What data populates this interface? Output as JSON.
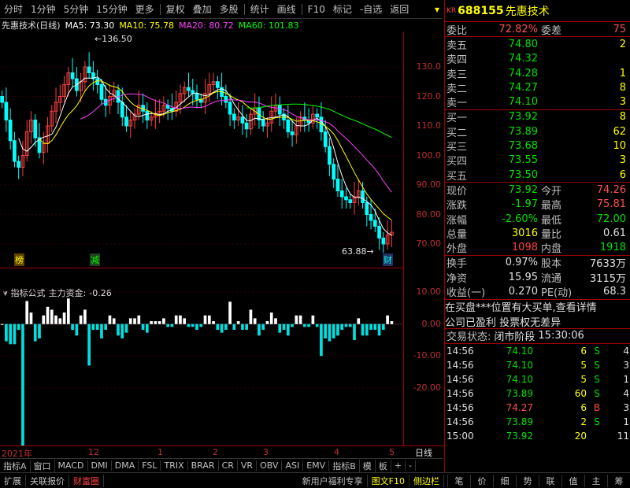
{
  "toolbar": {
    "items": [
      "分时",
      "1分钟",
      "5分钟",
      "15分钟",
      "更多",
      "复权",
      "叠加",
      "多股",
      "统计",
      "画线",
      "F10",
      "标记",
      "-自选",
      "返回"
    ]
  },
  "chart_title": {
    "name": "先惠技术(日线)",
    "ma5": "MA5: 73.30",
    "ma10": "MA10: 75.78",
    "ma20": "MA20: 80.72",
    "ma60": "MA60: 101.83"
  },
  "colors": {
    "ma5": "#ffffff",
    "ma10": "#ffff00",
    "ma20": "#ff40ff",
    "ma60": "#00ff00",
    "up": "#ff4040",
    "down": "#00ffff"
  },
  "price_axis": {
    "labels": [
      "130.0",
      "120.0",
      "110.0",
      "100.0",
      "90.00",
      "80.00",
      "70.00"
    ]
  },
  "ind_axis": {
    "labels": [
      "10.00",
      "0.00",
      "-10.00",
      "-20.00"
    ]
  },
  "annotations": {
    "high": "136.50",
    "low": "63.88",
    "tag_bang": "榜",
    "tag_jian": "减",
    "tag_cai": "财"
  },
  "indicator": {
    "label": "指标公式",
    "name": "主力资金:",
    "value": "-0.26"
  },
  "xaxis": {
    "labels": [
      "2021年",
      "12",
      "1",
      "2",
      "3",
      "4",
      "5"
    ],
    "period": "日线"
  },
  "tabs": [
    "指标A",
    "窗口",
    "MACD",
    "DMI",
    "DMA",
    "FSL",
    "TRIX",
    "BRAR",
    "CR",
    "VR",
    "OBV",
    "ASI",
    "EMV",
    "指标B",
    "模",
    "板",
    "+",
    "-"
  ],
  "bottom": {
    "items": [
      "扩展",
      "关联报价",
      "财富圈",
      "新用户福利专享",
      "图文F10",
      "侧边栏"
    ],
    "right": [
      "笔",
      "价",
      "细",
      "势",
      "联",
      "值",
      "主",
      "筹"
    ]
  },
  "stock": {
    "kr": "KR",
    "code": "688155",
    "name": "先惠技术"
  },
  "commission": {
    "ratio_label": "委比",
    "ratio": "72.82%",
    "diff_label": "委差",
    "diff": "75"
  },
  "sell": [
    {
      "k": "卖五",
      "p": "74.80",
      "v": "2"
    },
    {
      "k": "卖四",
      "p": "74.32",
      "v": ""
    },
    {
      "k": "卖三",
      "p": "74.28",
      "v": "1"
    },
    {
      "k": "卖二",
      "p": "74.27",
      "v": "8"
    },
    {
      "k": "卖一",
      "p": "74.10",
      "v": "3"
    }
  ],
  "buy": [
    {
      "k": "买一",
      "p": "73.92",
      "v": "8"
    },
    {
      "k": "买二",
      "p": "73.89",
      "v": "62"
    },
    {
      "k": "买三",
      "p": "73.68",
      "v": "10"
    },
    {
      "k": "买四",
      "p": "73.55",
      "v": "3"
    },
    {
      "k": "买五",
      "p": "73.50",
      "v": "6"
    }
  ],
  "quote": [
    {
      "k1": "现价",
      "v1": "73.92",
      "k2": "今开",
      "v2": "74.26"
    },
    {
      "k1": "涨跌",
      "v1": "-1.97",
      "k2": "最高",
      "v2": "75.81"
    },
    {
      "k1": "涨幅",
      "v1": "-2.60%",
      "k2": "最低",
      "v2": "72.00"
    },
    {
      "k1": "总量",
      "v1": "3016",
      "k2": "量比",
      "v2": "0.61"
    },
    {
      "k1": "外盘",
      "v1": "1098",
      "k2": "内盘",
      "v2": "1918"
    }
  ],
  "stats": [
    {
      "k1": "换手",
      "v1": "0.97%",
      "k2": "股本",
      "v2": "7633万"
    },
    {
      "k1": "净资",
      "v1": "15.95",
      "k2": "流通",
      "v2": "3115万"
    },
    {
      "k1": "收益(一)",
      "v1": "0.270",
      "k2": "PE(动)",
      "v2": "68.3"
    }
  ],
  "news": [
    "在买盘***位置有大买单,查看详情",
    "公司已盈利 投票权无差异"
  ],
  "trade_status": {
    "label": "交易状态:",
    "value": "闭市阶段",
    "time": "15:30:06"
  },
  "ticks": [
    {
      "t": "14:56",
      "p": "74.10",
      "v": "6",
      "s": "S",
      "n": "4"
    },
    {
      "t": "14:56",
      "p": "74.10",
      "v": "5",
      "s": "S",
      "n": "3"
    },
    {
      "t": "14:56",
      "p": "74.10",
      "v": "5",
      "s": "S",
      "n": "1"
    },
    {
      "t": "14:56",
      "p": "73.89",
      "v": "60",
      "s": "S",
      "n": "4"
    },
    {
      "t": "14:56",
      "p": "74.27",
      "v": "6",
      "s": "B",
      "n": "3"
    },
    {
      "t": "14:56",
      "p": "73.89",
      "v": "2",
      "s": "S",
      "n": "1"
    },
    {
      "t": "15:00",
      "p": "73.92",
      "v": "20",
      "s": "",
      "n": "11"
    }
  ],
  "chart_data": {
    "type": "candlestick",
    "close": [
      118,
      112,
      105,
      98,
      96,
      100,
      108,
      112,
      106,
      101,
      104,
      110,
      115,
      118,
      120,
      124,
      128,
      126,
      122,
      125,
      130,
      128,
      126,
      124,
      119,
      117,
      120,
      122,
      118,
      113,
      110,
      112,
      114,
      117,
      115,
      112,
      113,
      114,
      115,
      117,
      116,
      115,
      118,
      121,
      123,
      122,
      121,
      119,
      118,
      121,
      124,
      125,
      123,
      120,
      118,
      114,
      112,
      113,
      111,
      109,
      114,
      116,
      112,
      110,
      111,
      115,
      117,
      114,
      112,
      108,
      107,
      110,
      113,
      112,
      111,
      114,
      113,
      108,
      103,
      97,
      92,
      88,
      86,
      85,
      84,
      86,
      88,
      84,
      80,
      78,
      76,
      72,
      70,
      73,
      74
    ]
  }
}
